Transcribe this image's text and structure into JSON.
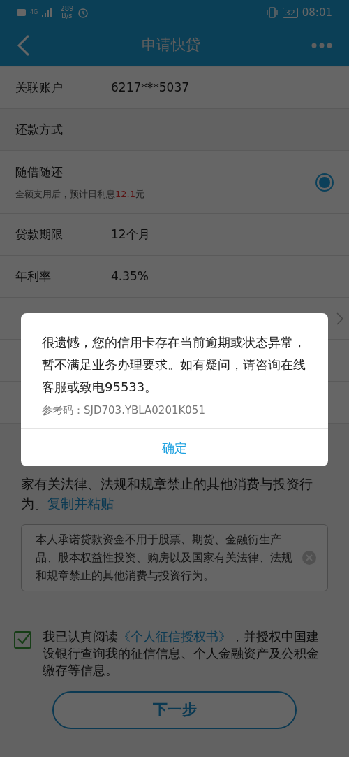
{
  "status_bar": {
    "network": "4G",
    "speed": "289",
    "speed_unit": "B/s",
    "battery": "32",
    "time": "08:01"
  },
  "header": {
    "title": "申请快贷"
  },
  "rows": [
    {
      "kind": "field",
      "label": "关联账户",
      "value": "6217***5037"
    },
    {
      "kind": "header",
      "label": "还款方式"
    },
    {
      "kind": "option",
      "label": "随借随还",
      "note_before": "全额支用后，预计日利息",
      "note_amount": "12.1",
      "note_after": "元",
      "selected": true
    },
    {
      "kind": "field",
      "label": "贷款期限",
      "value": "12个月"
    },
    {
      "kind": "field",
      "label": "年利率",
      "value": "4.35%"
    },
    {
      "kind": "chevron"
    },
    {
      "kind": "blank"
    },
    {
      "kind": "blank"
    }
  ],
  "pledge": {
    "text": "家有关法律、法规和规章禁止的其他消费与投资行为。",
    "link": "复制并粘贴",
    "input_value": "本人承诺贷款资金不用于股票、期货、金融衍生产品、股本权益性投资、购房以及国家有关法律、法规和规章禁止的其他消费与投资行为。"
  },
  "agreement": {
    "checked": true,
    "before": "我已认真阅读",
    "link": "《个人征信授权书》",
    "after": "，并授权中国建设银行查询我的征信信息、个人金融资产及公积金缴存等信息。"
  },
  "next_button": "下一步",
  "dialog": {
    "message": "很遗憾，您的信用卡存在当前逾期或状态异常，暂不满足业务办理要求。如有疑问，请咨询在线客服或致电95533。",
    "reference": "参考码：SJD703.YBLA0201K051",
    "button": "确定"
  }
}
